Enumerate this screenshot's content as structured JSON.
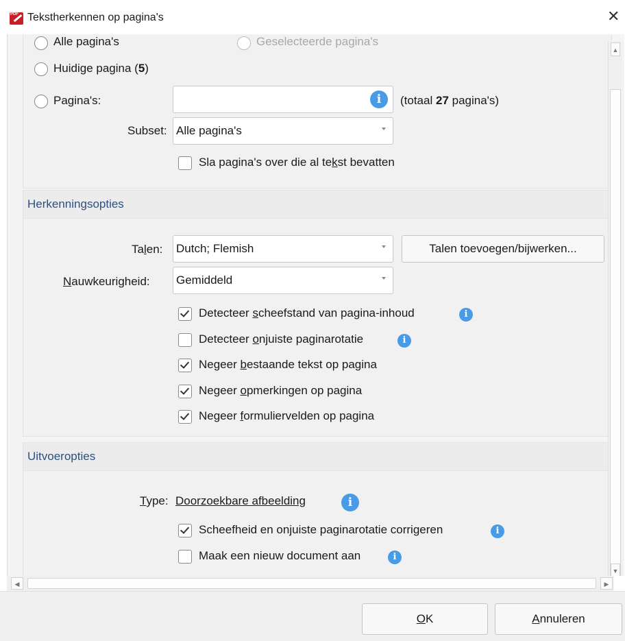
{
  "window": {
    "title": "Tekstherkennen op pagina's",
    "close_glyph": "✕",
    "icon_text": "PDF"
  },
  "pages": {
    "partial_top_left": "Alle pagina's",
    "partial_top_right": "Geselecteerde pagina's",
    "current_label": "Huidige pagina (",
    "current_num": "5",
    "current_end": ")",
    "pages_label": "Pagina's:",
    "pages_input_value": "",
    "total_prefix": "(totaal ",
    "total_num": "27",
    "total_suffix": " pagina's)",
    "subset_label": "Subset:",
    "subset_value": "Alle pagina's",
    "skip_pre": "Sla pagina's over die al te",
    "skip_key": "k",
    "skip_post": "st bevatten"
  },
  "recognition": {
    "header": "Herkenningsopties",
    "lang_pre": "Ta",
    "lang_key": "l",
    "lang_post": "en:",
    "lang_value": "Dutch; Flemish",
    "lang_button": "Talen toevoegen/bijwerken...",
    "acc_key": "N",
    "acc_post": "auwkeurigheid:",
    "acc_value": "Gemiddeld",
    "opt1_pre": "Detecteer ",
    "opt1_key": "s",
    "opt1_post": "cheefstand van pagina-inhoud",
    "opt2_pre": "Detecteer ",
    "opt2_key": "o",
    "opt2_post": "njuiste paginarotatie",
    "opt3_pre": "Negeer ",
    "opt3_key": "b",
    "opt3_post": "estaande tekst op pagina",
    "opt4_pre": "Negeer ",
    "opt4_key": "o",
    "opt4_post": "pmerkingen op pagina",
    "opt5_pre": "Negeer ",
    "opt5_key": "f",
    "opt5_post": "ormuliervelden op pagina"
  },
  "output": {
    "header": "Uitvoeropties",
    "type_key": "T",
    "type_post": "ype:",
    "type_value": "Doorzoekbare afbeelding",
    "opt1": "Scheefheid en onjuiste paginarotatie corrigeren",
    "opt2": "Maak een nieuw document aan"
  },
  "buttons": {
    "ok_key": "O",
    "ok_post": "K",
    "cancel_key": "A",
    "cancel_post": "nnuleren"
  },
  "info_glyph": "i",
  "states": {
    "current_page_selected": false,
    "pages_selected": false,
    "skip_text_pages": false,
    "detect_skew": true,
    "detect_rotation": false,
    "ignore_text": true,
    "ignore_comments": true,
    "ignore_forms": true,
    "correct_skew": true,
    "new_document": false
  },
  "colors": {
    "accent_info": "#4a9be6",
    "group_header_text": "#2f4f7a",
    "app_icon": "#c81f24"
  }
}
